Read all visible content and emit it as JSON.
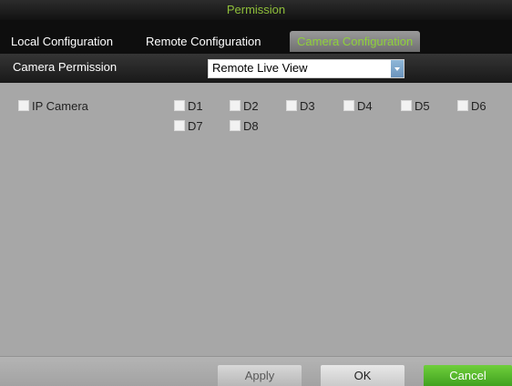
{
  "window": {
    "title": "Permission"
  },
  "tabs": [
    {
      "label": "Local Configuration",
      "active": false
    },
    {
      "label": "Remote Configuration",
      "active": false
    },
    {
      "label": "Camera Configuration",
      "active": true
    }
  ],
  "permission": {
    "label": "Camera Permission",
    "selected": "Remote Live View"
  },
  "checkboxes": {
    "ip_camera": {
      "label": "IP Camera",
      "checked": false
    },
    "channels": [
      {
        "label": "D1",
        "checked": false
      },
      {
        "label": "D2",
        "checked": false
      },
      {
        "label": "D3",
        "checked": false
      },
      {
        "label": "D4",
        "checked": false
      },
      {
        "label": "D5",
        "checked": false
      },
      {
        "label": "D6",
        "checked": false
      },
      {
        "label": "D7",
        "checked": false
      },
      {
        "label": "D8",
        "checked": false
      }
    ]
  },
  "buttons": {
    "apply": "Apply",
    "ok": "OK",
    "cancel": "Cancel"
  },
  "colors": {
    "accent_green": "#8fbf3a",
    "cancel_green": "#4caf2a",
    "panel_gray": "#a7a7a7"
  }
}
